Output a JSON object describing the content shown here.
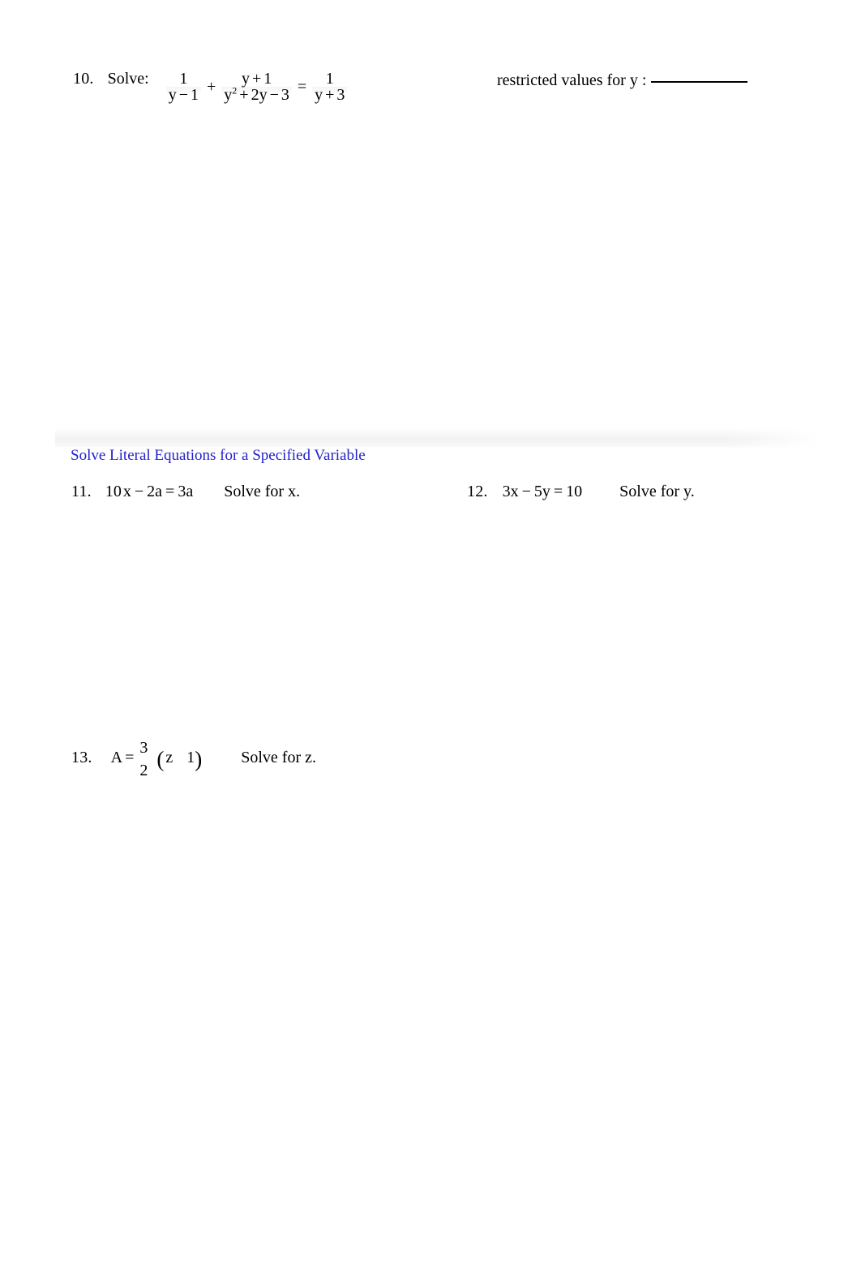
{
  "page": {
    "background_color": "#ffffff",
    "text_color": "#000000"
  },
  "problems": {
    "q10": {
      "number": "10.",
      "prompt": "Solve:",
      "equation": {
        "term1": {
          "numerator": "1",
          "denominator_var": "y",
          "denominator_op": "−",
          "denominator_num": "1"
        },
        "plus": "+",
        "term2": {
          "numerator_var": "y",
          "numerator_op": "+",
          "numerator_num": "1",
          "den_var": "y",
          "den_exp": "2",
          "den_op1": "+",
          "den_coef": "2",
          "den_var2": "y",
          "den_op2": "−",
          "den_num": "3"
        },
        "equals": "=",
        "term3": {
          "numerator": "1",
          "denominator_var": "y",
          "denominator_op": "+",
          "denominator_num": "3"
        }
      },
      "restricted_label": "restricted values for y :",
      "restricted_answer": ""
    },
    "q11": {
      "number": "11.",
      "coefficient": "10",
      "var1": "x",
      "op1": "−",
      "term2": "2a",
      "equals": "=",
      "rhs": "3a",
      "instruction": "Solve for x."
    },
    "q12": {
      "number": "12.",
      "coefficient": "3",
      "var1": "x",
      "op1": "−",
      "term2": "5y",
      "equals": "=",
      "rhs": "10",
      "instruction": "Solve for y."
    },
    "q13": {
      "number": "13.",
      "lhs": "A",
      "equals": "=",
      "fraction_numerator": "3",
      "fraction_denominator": "2",
      "paren_open": "(",
      "inner_var": "z",
      "inner_missing_op": "",
      "inner_num": "1",
      "paren_close": ")",
      "instruction": "Solve for z."
    }
  },
  "section": {
    "title": "Solve Literal Equations for a Specified Variable",
    "title_color": "#2222cc",
    "band_color": "#f0f0f0"
  }
}
